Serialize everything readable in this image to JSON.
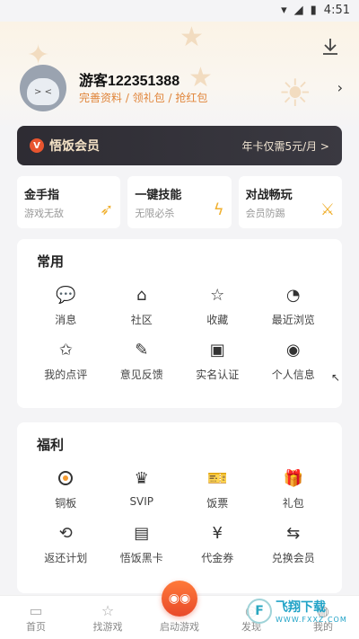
{
  "status": {
    "time": "4:51"
  },
  "profile": {
    "username": "游客122351388",
    "links": "完善资料 / 领礼包 / 抢红包"
  },
  "vip": {
    "title": "悟饭会员",
    "promo": "年卡仅需5元/月 >"
  },
  "perks": [
    {
      "title": "金手指",
      "subtitle": "游戏无敌"
    },
    {
      "title": "一键技能",
      "subtitle": "无限必杀"
    },
    {
      "title": "对战畅玩",
      "subtitle": "会员防踢"
    }
  ],
  "common": {
    "title": "常用",
    "items": [
      {
        "label": "消息",
        "icon": "message-icon"
      },
      {
        "label": "社区",
        "icon": "home-icon"
      },
      {
        "label": "收藏",
        "icon": "star-icon"
      },
      {
        "label": "最近浏览",
        "icon": "history-icon"
      },
      {
        "label": "我的点评",
        "icon": "review-star-icon"
      },
      {
        "label": "意见反馈",
        "icon": "feedback-icon"
      },
      {
        "label": "实名认证",
        "icon": "id-card-icon"
      },
      {
        "label": "个人信息",
        "icon": "person-icon"
      }
    ]
  },
  "welfare": {
    "title": "福利",
    "items": [
      {
        "label": "铜板",
        "icon": "coin-icon"
      },
      {
        "label": "SVIP",
        "icon": "crown-icon"
      },
      {
        "label": "饭票",
        "icon": "ticket-icon"
      },
      {
        "label": "礼包",
        "icon": "gift-icon"
      },
      {
        "label": "返还计划",
        "icon": "return-icon"
      },
      {
        "label": "悟饭黑卡",
        "icon": "black-card-icon"
      },
      {
        "label": "代金券",
        "icon": "voucher-icon"
      },
      {
        "label": "兑换会员",
        "icon": "exchange-icon"
      }
    ]
  },
  "tabs": [
    {
      "label": "首页",
      "icon": "home-tab-icon"
    },
    {
      "label": "找游戏",
      "icon": "star-tab-icon"
    },
    {
      "label": "启动游戏",
      "icon": "gamepad-icon"
    },
    {
      "label": "发现",
      "icon": "discover-icon"
    },
    {
      "label": "我的",
      "icon": "me-icon"
    }
  ],
  "watermark": {
    "text": "飞翔下载",
    "sub": "WWW.FXXZ.COM"
  },
  "colors": {
    "accent": "#e0853a",
    "vip_bg": "#2e2c33",
    "start": "#e84a2a"
  }
}
